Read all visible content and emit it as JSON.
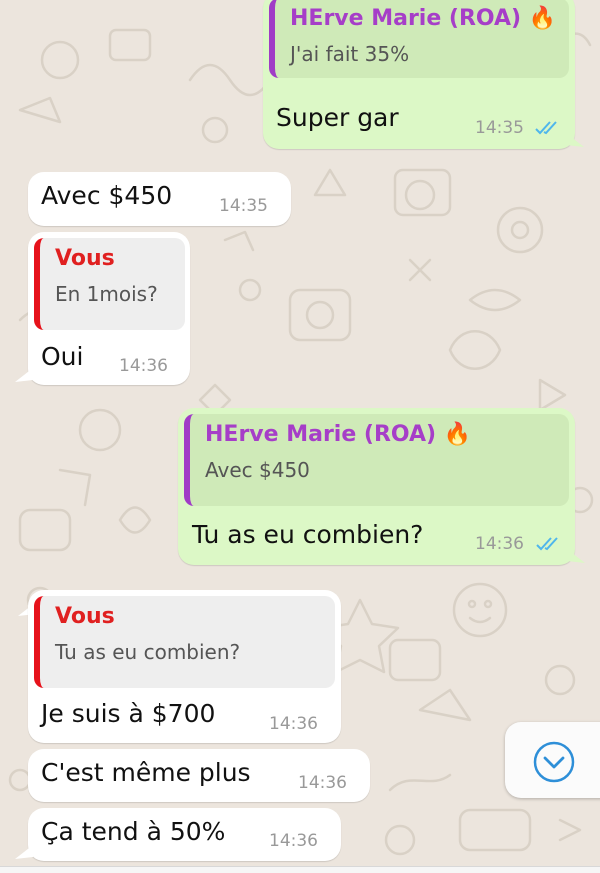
{
  "colors": {
    "wallpaper": "#ece5dd",
    "incoming_bubble": "#ffffff",
    "outgoing_bubble": "#dcf8c6",
    "quote_outgoing_bar": "#a03cc6",
    "quote_incoming_bar": "#e6121b",
    "read_ticks": "#4fb6ec",
    "scroll_button_icon": "#2e8fd8"
  },
  "messages": [
    {
      "direction": "outgoing",
      "quote": {
        "author": "HErve Marie (ROA)",
        "author_emoji": "🔥",
        "text": "J'ai fait 35%"
      },
      "text": "Super gar",
      "time": "14:35",
      "status_icon": "double-check-icon"
    },
    {
      "direction": "incoming",
      "text": "Avec $450",
      "time": "14:35"
    },
    {
      "direction": "incoming",
      "quote": {
        "author": "Vous",
        "text": "En 1mois?"
      },
      "text": "Oui",
      "time": "14:36"
    },
    {
      "direction": "outgoing",
      "quote": {
        "author": "HErve Marie (ROA)",
        "author_emoji": "🔥",
        "text": "Avec $450"
      },
      "text": "Tu as eu combien?",
      "time": "14:36",
      "status_icon": "double-check-icon"
    },
    {
      "direction": "incoming",
      "quote": {
        "author": "Vous",
        "text": "Tu as eu combien?"
      },
      "text": "Je suis à $700",
      "time": "14:36"
    },
    {
      "direction": "incoming",
      "text": "C'est même plus",
      "time": "14:36"
    },
    {
      "direction": "incoming",
      "text": "Ça tend à 50%",
      "time": "14:36"
    }
  ],
  "scroll_button": {
    "icon": "chevron-down-circle-icon"
  }
}
